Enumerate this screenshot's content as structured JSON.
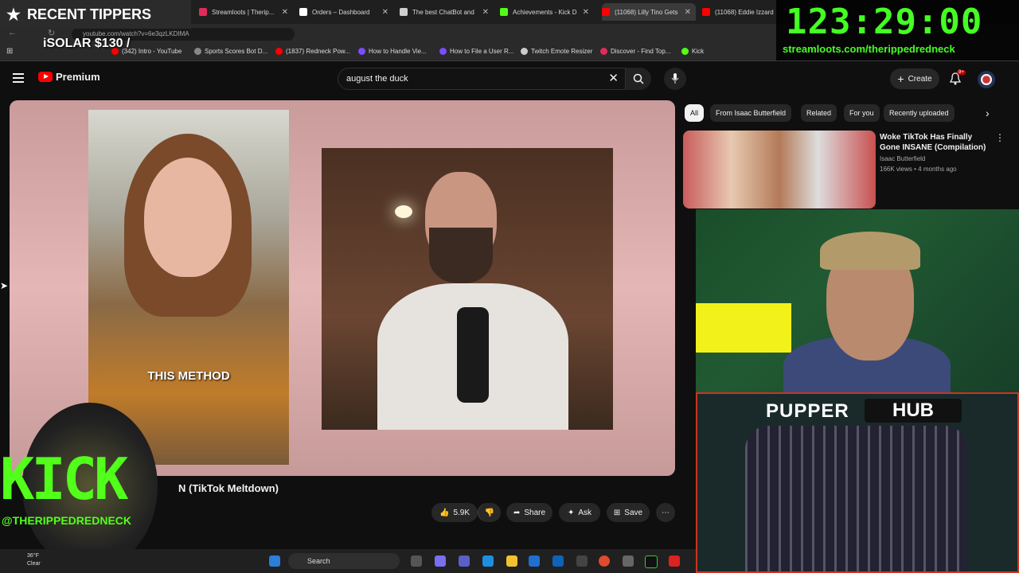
{
  "browser": {
    "tabs": [
      {
        "label": "Streamloots | Therip...",
        "color": "#e02b5b"
      },
      {
        "label": "Orders – Dashboard",
        "color": "#ffffff"
      },
      {
        "label": "The best ChatBot and",
        "color": "#cfcfcf"
      },
      {
        "label": "Achievements - Kick D",
        "color": "#53fc18"
      },
      {
        "label": "(11068) Lilly Tino Gets",
        "color": "#ff0000"
      },
      {
        "label": "(11068) Eddie Izzard",
        "color": "#ff0000"
      }
    ],
    "url": "youtube.com/watch?v=6e3qzLKDIMA",
    "bookmarks": [
      {
        "label": "(342) Intro - YouTube",
        "color": "#ff0000"
      },
      {
        "label": "Sports Scores Bot D...",
        "color": "#888888"
      },
      {
        "label": "(1837) Redneck Pow...",
        "color": "#ff0000"
      },
      {
        "label": "How to Handle Vie...",
        "color": "#7b4dff"
      },
      {
        "label": "How to File a User R...",
        "color": "#7b4dff"
      },
      {
        "label": "Twitch Emote Resizer",
        "color": "#cccccc"
      },
      {
        "label": "Discover - Find Top...",
        "color": "#e02b5b"
      },
      {
        "label": "Kick",
        "color": "#53fc18"
      }
    ]
  },
  "youtube": {
    "brand": "Premium",
    "search_value": "august the duck",
    "create_label": "Create",
    "notif_count": "9+",
    "video_title": "N (TikTok Meltdown)",
    "caption": "THIS METHOD",
    "actions": {
      "like_count": "5.9K",
      "share": "Share",
      "ask": "Ask",
      "save": "Save"
    },
    "chips": [
      "All",
      "From Isaac Butterfield",
      "Related",
      "For you",
      "Recently uploaded"
    ],
    "related": {
      "title": "Woke TikTok Has Finally Gone INSANE (Compilation)",
      "channel": "Isaac Butterfield",
      "meta": "166K views • 4 months ago"
    }
  },
  "overlays": {
    "recent_tippers": "RECENT TIPPERS",
    "timer": "123:29:00",
    "timer_url": "streamloots.com/therippedredneck",
    "solar": "iSOLAR $130 /",
    "kick_word": "KICK",
    "kick_handle": "@THERIPPEDREDNECK",
    "pupper_1": "PUPPER",
    "pupper_2": "HUB"
  },
  "taskbar": {
    "temp": "36°F",
    "condition": "Clear",
    "search": "Search"
  }
}
